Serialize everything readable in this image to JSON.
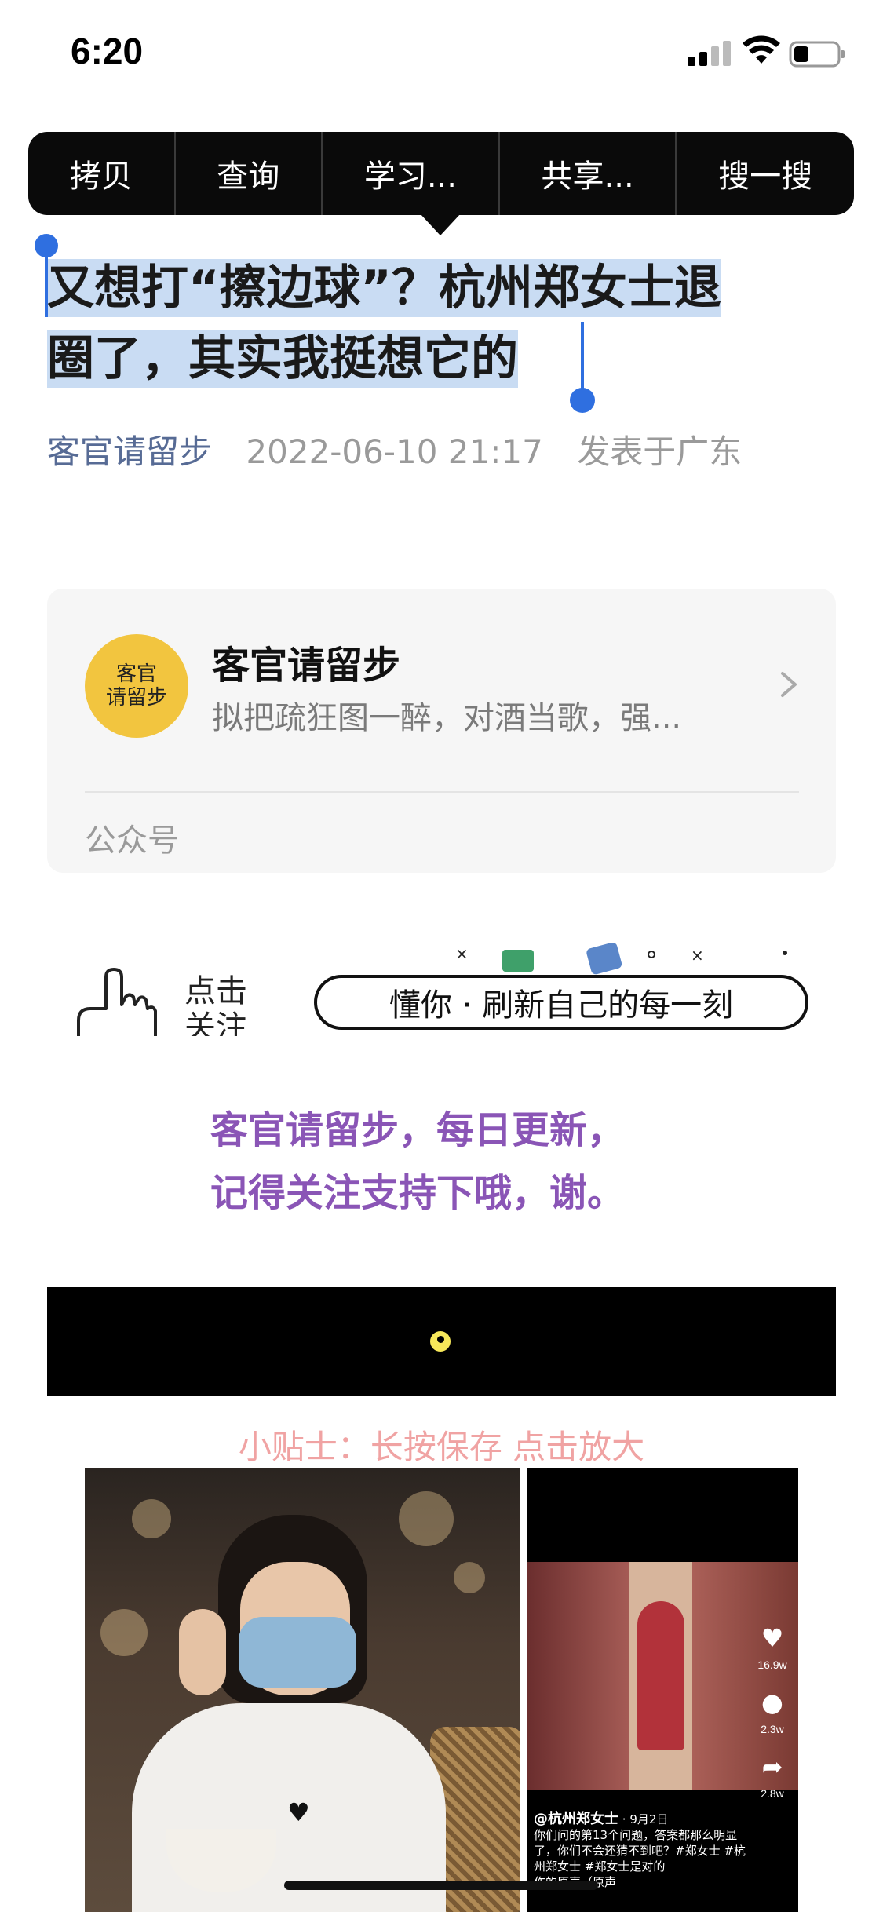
{
  "status_bar": {
    "time": "6:20"
  },
  "context_menu": {
    "items": [
      "拷贝",
      "查询",
      "学习...",
      "共享...",
      "搜一搜"
    ]
  },
  "article": {
    "title_line1": "又想打“擦边球”？杭州郑女士退",
    "title_line2": "圈了，其实我挺想它的",
    "author": "客官请留步",
    "date": "2022-06-10 21:17",
    "location": "发表于广东"
  },
  "account_card": {
    "avatar_text_line1": "客官",
    "avatar_text_line2": "请留步",
    "name": "客官请留步",
    "description": "拟把疏狂图一醉，对酒当歌，强...",
    "type": "公众号"
  },
  "banner": {
    "click_text_line1": "点击",
    "click_text_line2": "关注",
    "slogan": "懂你 · 刷新自己的每一刻"
  },
  "promo": {
    "line1": "客官请留步，每日更新，",
    "line2": "记得关注支持下哦，谢。"
  },
  "tip": "小贴士：长按保存 点击放大",
  "right_photo": {
    "counts": [
      "16.9w",
      "2.3w",
      "2.8w"
    ],
    "handle": "@杭州郑女士",
    "date": "· 9月2日",
    "caption": "你们问的第13个问题，答案都那么明显了，你们不会还猜不到吧？#郑女士 #杭州郑女士 #郑女士是对的",
    "sound": "作的原声（原声"
  },
  "colors": {
    "selection": "#c9dcf3",
    "handle": "#2f6fe0",
    "author_link": "#576b95",
    "promo_purple": "#8a55b6",
    "tip_pink": "#f0a3a3",
    "avatar_yellow": "#f2c53f"
  },
  "icons": [
    "signal-icon",
    "wifi-icon",
    "battery-icon",
    "chevron-right-icon",
    "pointing-hand-icon",
    "heart-icon",
    "comment-icon",
    "share-icon"
  ]
}
